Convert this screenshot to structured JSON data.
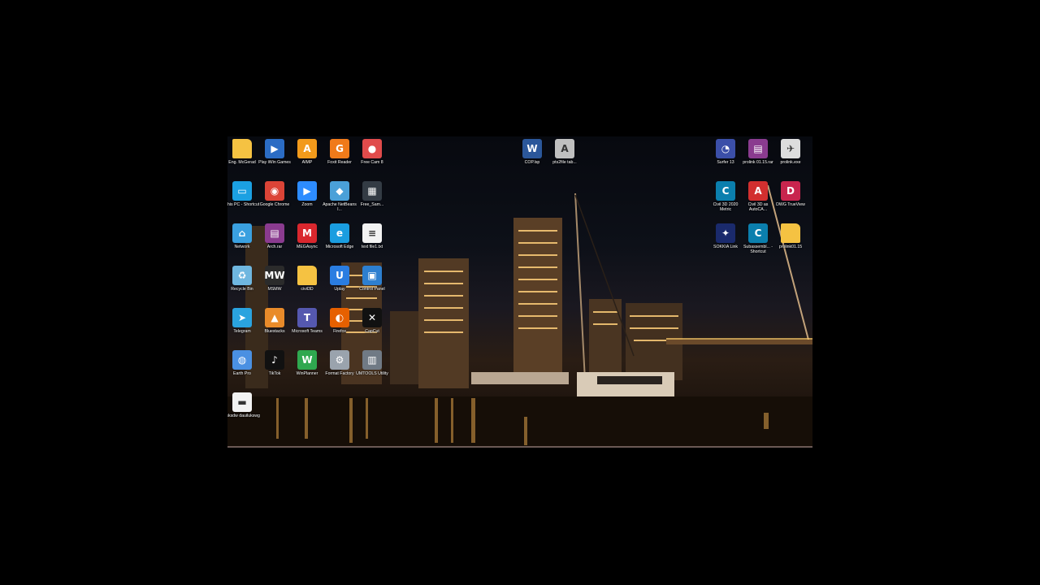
{
  "desktop": {
    "left_icons": [
      {
        "label": "Eng. McGerad",
        "icon": "folder-icon",
        "color": "#f5c242"
      },
      {
        "label": "Play iWin Games",
        "icon": "play-store-icon",
        "color": "#2b6cc4"
      },
      {
        "label": "AIMP",
        "icon": "aimp-icon",
        "color": "#f29a1b"
      },
      {
        "label": "Foxit Reader",
        "icon": "foxit-reader-icon",
        "color": "#f07a1a"
      },
      {
        "label": "Free Cam 8",
        "icon": "freecam-icon",
        "color": "#e04b4b"
      },
      {
        "label": "This PC - Shortcut",
        "icon": "this-pc-icon",
        "color": "#1ba0e2"
      },
      {
        "label": "Google Chrome",
        "icon": "chrome-icon",
        "color": "#db4437"
      },
      {
        "label": "Zoom",
        "icon": "zoom-icon",
        "color": "#2d8cff"
      },
      {
        "label": "Apache NetBeans I...",
        "icon": "netbeans-icon",
        "color": "#4aa0d8"
      },
      {
        "label": "Free_Sam...",
        "icon": "application-icon",
        "color": "#333b44"
      },
      {
        "label": "Network",
        "icon": "network-icon",
        "color": "#3aa0e0"
      },
      {
        "label": "Arch.rar",
        "icon": "winrar-icon",
        "color": "#8a3b8f"
      },
      {
        "label": "MEGAsync",
        "icon": "mega-icon",
        "color": "#d9272e"
      },
      {
        "label": "Microsoft Edge",
        "icon": "edge-icon",
        "color": "#1a9de0"
      },
      {
        "label": "text file1.txt",
        "icon": "text-file-icon",
        "color": "#f2f2f2"
      },
      {
        "label": "Recycle Bin",
        "icon": "recycle-bin-icon",
        "color": "#6fb7e0"
      },
      {
        "label": "MSMW",
        "icon": "msmw-icon",
        "color": "#2b2b2b"
      },
      {
        "label": "civil3D",
        "icon": "folder-icon",
        "color": "#f5c242"
      },
      {
        "label": "Uplay",
        "icon": "uplay-icon",
        "color": "#2a7de1"
      },
      {
        "label": "Control Panel",
        "icon": "control-panel-icon",
        "color": "#2d7fd0"
      },
      {
        "label": "Telegram",
        "icon": "telegram-icon",
        "color": "#2aa3df"
      },
      {
        "label": "Bluestacks",
        "icon": "bluestacks-icon",
        "color": "#e98b2a"
      },
      {
        "label": "Microsoft Teams",
        "icon": "teams-icon",
        "color": "#5558af"
      },
      {
        "label": "Firefox",
        "icon": "firefox-icon",
        "color": "#e66000"
      },
      {
        "label": "CapCut",
        "icon": "capcut-icon",
        "color": "#111111"
      },
      {
        "label": "Earth Pro",
        "icon": "google-earth-icon",
        "color": "#4a90e2"
      },
      {
        "label": "TikTok",
        "icon": "tiktok-icon",
        "color": "#111111"
      },
      {
        "label": "WinPlanner",
        "icon": "winplanner-icon",
        "color": "#2fa84f"
      },
      {
        "label": "Format Factory",
        "icon": "format-factory-icon",
        "color": "#9aa3ad"
      },
      {
        "label": "UMTOOLS Utility",
        "icon": "umtools-icon",
        "color": "#707a85"
      },
      {
        "label": "lisksdw dauilukswg",
        "icon": "image-file-icon",
        "color": "#f2f2f2"
      }
    ],
    "center_icons": [
      {
        "label": "COP.lsp",
        "icon": "word-doc-icon",
        "color": "#2b579a"
      },
      {
        "label": "pts2file tab...",
        "icon": "autocad-file-icon",
        "color": "#bfbfbf"
      }
    ],
    "right_icons": [
      {
        "label": "Surfer 13",
        "icon": "surfer-icon",
        "color": "#3b4fa8"
      },
      {
        "label": "prolink 01.15.rar",
        "icon": "winrar-icon",
        "color": "#8a3b8f"
      },
      {
        "label": "prolink.exe",
        "icon": "prolink-exe-icon",
        "color": "#dddddd"
      },
      {
        "label": "Civil 3D 2020 Metric",
        "icon": "civil3d-icon",
        "color": "#0b7fae"
      },
      {
        "label": "Civil 3D as AutoCA...",
        "icon": "autocad-icon",
        "color": "#d22f2f"
      },
      {
        "label": "DWG TrueView",
        "icon": "dwg-trueview-icon",
        "color": "#c8254e"
      },
      {
        "label": "SOKKIA Link",
        "icon": "sokkia-icon",
        "color": "#1a2a6c"
      },
      {
        "label": "Subassembl... - Shortcut",
        "icon": "subassembly-icon",
        "color": "#0b7fae"
      },
      {
        "label": "prolink01.15",
        "icon": "folder-icon",
        "color": "#f5c242"
      }
    ],
    "glyphs": {
      "folder-icon": "",
      "play-store-icon": "▶",
      "aimp-icon": "A",
      "foxit-reader-icon": "G",
      "freecam-icon": "●",
      "this-pc-icon": "▭",
      "chrome-icon": "◉",
      "zoom-icon": "▶",
      "netbeans-icon": "◆",
      "application-icon": "▦",
      "network-icon": "⌂",
      "winrar-icon": "▤",
      "mega-icon": "M",
      "edge-icon": "e",
      "text-file-icon": "≡",
      "recycle-bin-icon": "♻",
      "msmw-icon": "MW",
      "uplay-icon": "U",
      "control-panel-icon": "▣",
      "telegram-icon": "➤",
      "bluestacks-icon": "▲",
      "teams-icon": "T",
      "firefox-icon": "◐",
      "capcut-icon": "✕",
      "google-earth-icon": "◍",
      "tiktok-icon": "♪",
      "winplanner-icon": "W",
      "format-factory-icon": "⚙",
      "umtools-icon": "▥",
      "image-file-icon": "▬",
      "word-doc-icon": "W",
      "autocad-file-icon": "A",
      "surfer-icon": "◔",
      "prolink-exe-icon": "✈",
      "civil3d-icon": "C",
      "autocad-icon": "A",
      "dwg-trueview-icon": "D",
      "sokkia-icon": "✦",
      "subassembly-icon": "C"
    }
  }
}
